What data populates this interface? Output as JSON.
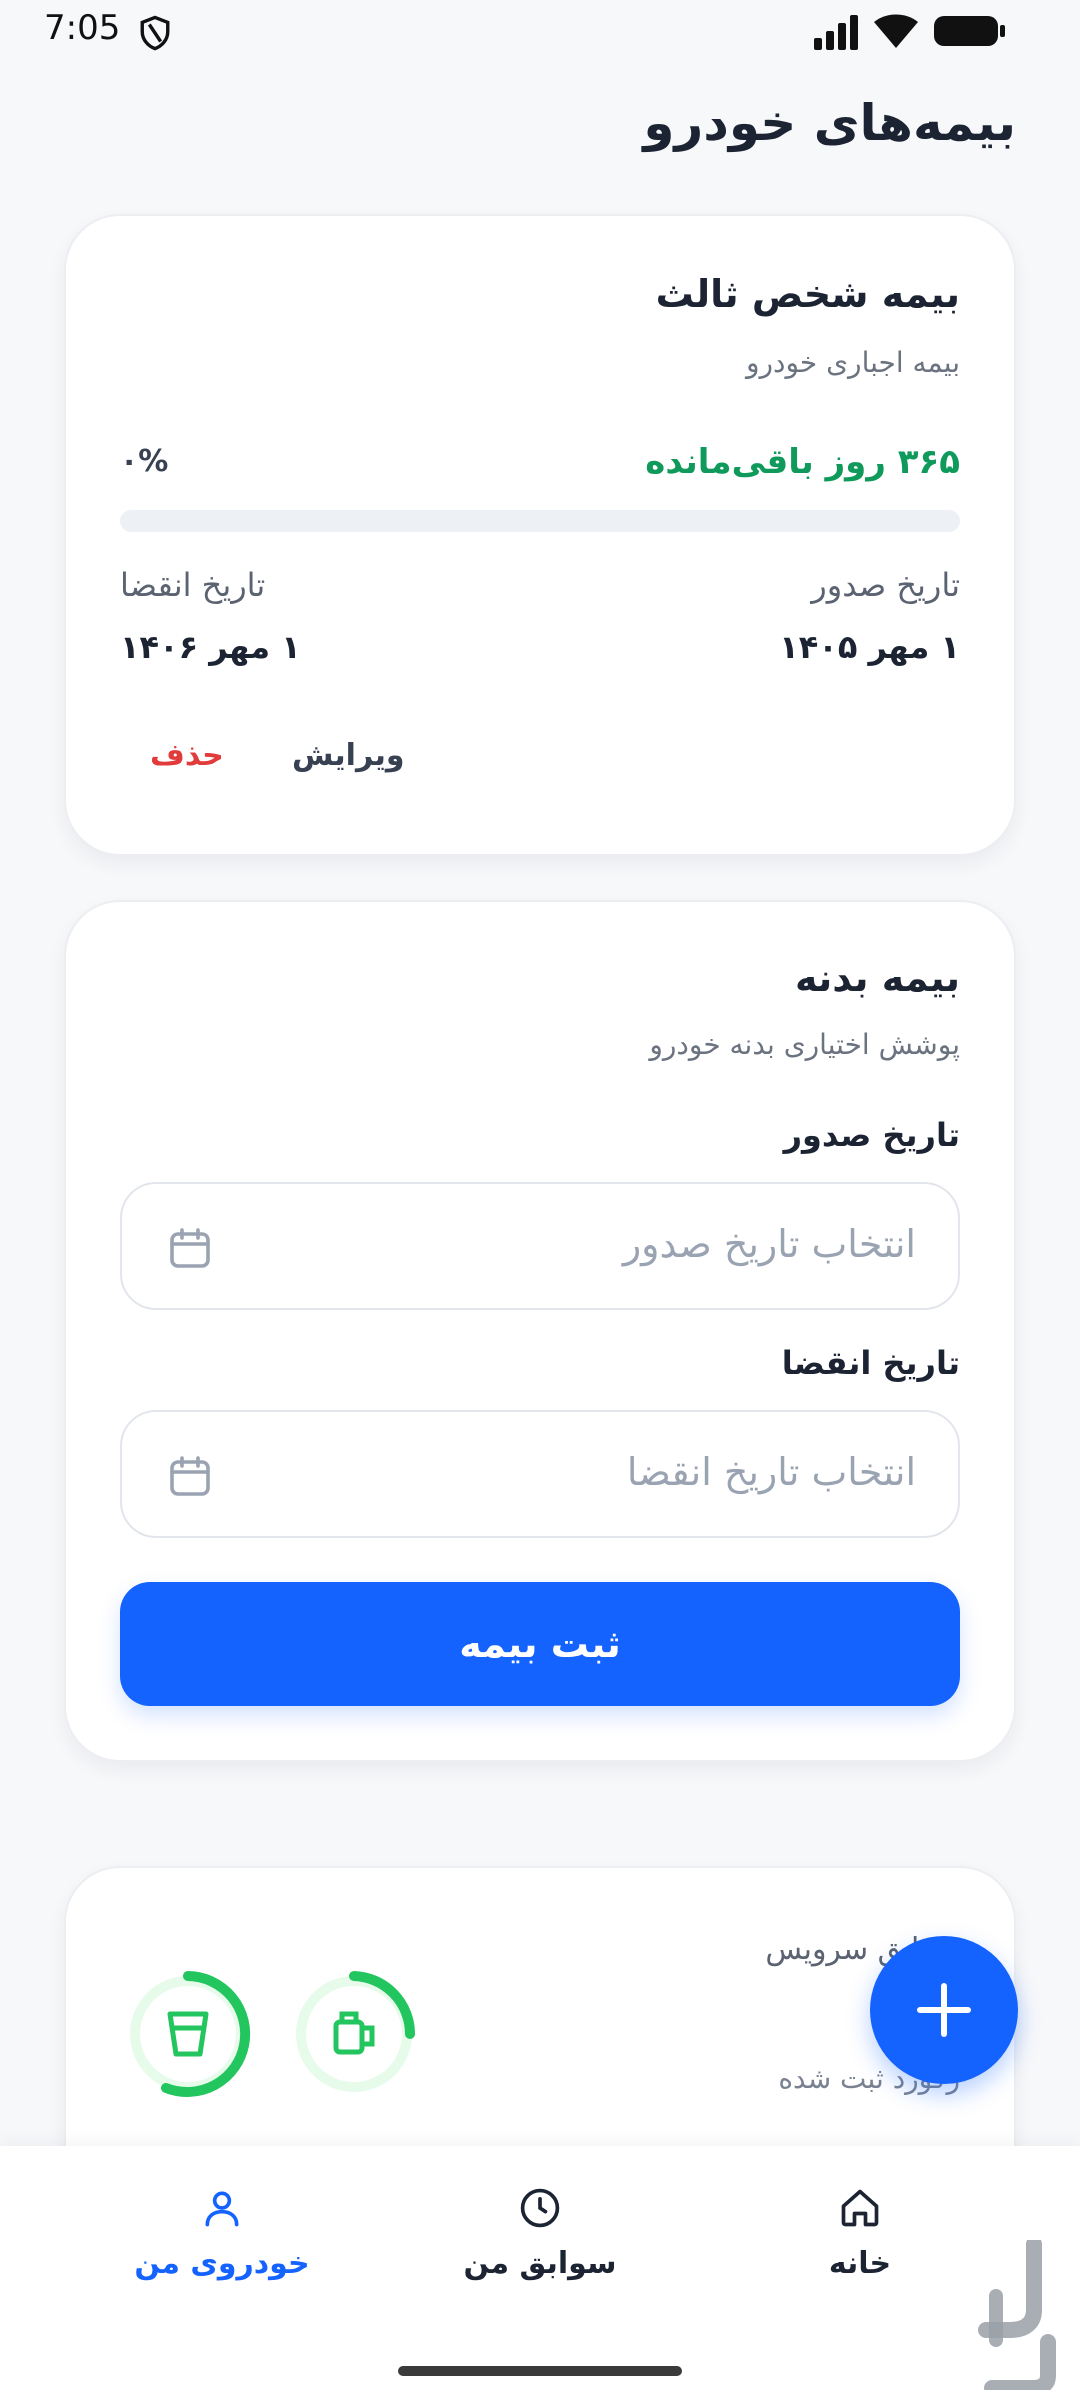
{
  "status_bar": {
    "time": "7:05"
  },
  "page": {
    "title": "بیمه‌های خودرو"
  },
  "third_party_card": {
    "title": "بیمه شخص ثالث",
    "subtitle": "بیمه اجباری خودرو",
    "remaining_text": "۳۶۵ روز باقی‌مانده",
    "percent_text": "۰%",
    "progress_fraction": 0,
    "issue_label": "تاریخ صدور",
    "issue_value": "۱ مهر ۱۴۰۵",
    "expiry_label": "تاریخ انقضا",
    "expiry_value": "۱ مهر ۱۴۰۶",
    "edit_label": "ویرایش",
    "delete_label": "حذف"
  },
  "body_card": {
    "title": "بیمه بدنه",
    "subtitle": "پوشش اختیاری بدنه خودرو",
    "issue_label": "تاریخ صدور",
    "issue_placeholder": "انتخاب تاریخ صدور",
    "expiry_label": "تاریخ انقضا",
    "expiry_placeholder": "انتخاب تاریخ انقضا",
    "submit_label": "ثبت بیمه"
  },
  "service_card": {
    "title": "سوابق سرویس",
    "subtitle": "رکورد ثبت شده"
  },
  "bottom_nav": {
    "home_label": "خانه",
    "history_label": "سوابق من",
    "mycar_label": "خودروی من"
  },
  "colors": {
    "primary": "#1463ff",
    "success": "#0f9a5c",
    "danger": "#e23b3b",
    "gauge": "#22c55e",
    "gauge_bg": "#e6fbea"
  }
}
